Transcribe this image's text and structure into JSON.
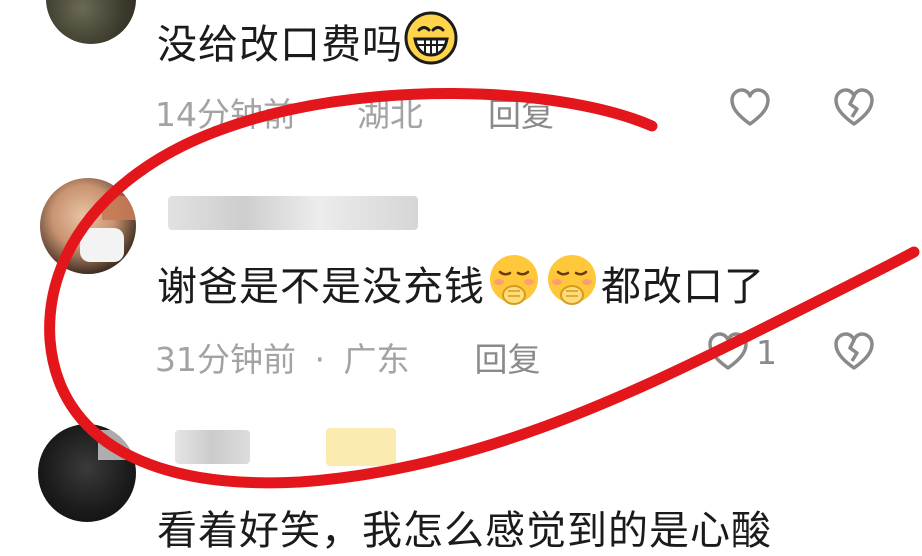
{
  "comments": [
    {
      "text": "没给改口费吗",
      "emoji": "grinning-face",
      "time": "14分钟前",
      "location": "湖北",
      "reply_label": "回复",
      "like_count": ""
    },
    {
      "text_part1": "谢爸是不是没充钱",
      "emoji": "thinking-hand-face",
      "text_part2": "都改口了",
      "time": "31分钟前",
      "separator": "·",
      "location": "广东",
      "reply_label": "回复",
      "like_count": "1"
    },
    {
      "text": "看着好笑，我怎么感觉到的是心酸"
    }
  ],
  "colors": {
    "annotation": "#e3161b",
    "meta": "#a3a3a3",
    "text": "#1b1b1b"
  }
}
